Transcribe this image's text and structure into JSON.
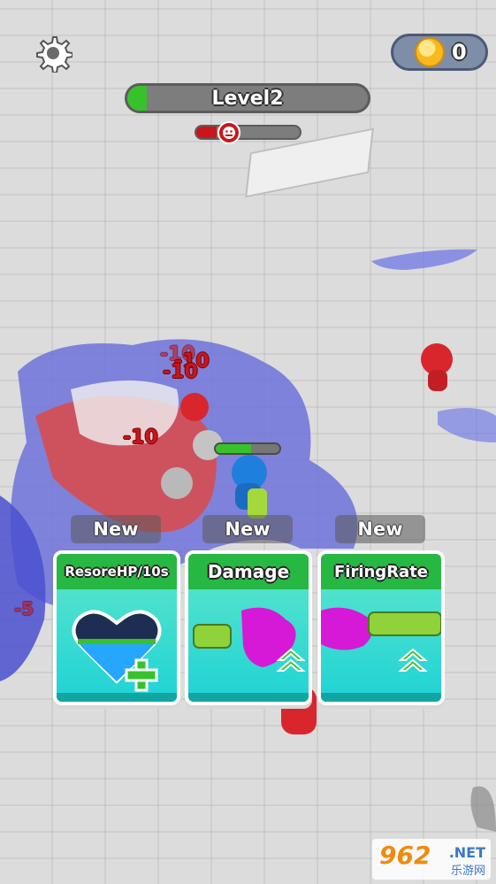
{
  "hud": {
    "settings_icon": "gear-icon",
    "coins": "0",
    "coin_icon": "coin-icon",
    "level_label": "Level2",
    "level_progress": 0.08,
    "boss_progress": 0.2,
    "boss_icon": "demon-face-icon"
  },
  "damage_texts": [
    "-10",
    "-10",
    "-10",
    "-10",
    "-5"
  ],
  "upgrades": {
    "new_labels": [
      "New",
      "New",
      "New"
    ],
    "cards": [
      {
        "title": "ResoreHP/10s",
        "icon": "heart-plus-icon"
      },
      {
        "title": "Damage",
        "icon": "paint-gun-damage-icon"
      },
      {
        "title": "FiringRate",
        "icon": "paint-gun-firing-icon"
      }
    ]
  },
  "watermark": {
    "main": "962",
    "suffix": ".NET",
    "chinese": "乐游网"
  },
  "colors": {
    "accent_green": "#37c22b",
    "boss_red": "#c8161c",
    "card_teal": "#1fd3d6",
    "title_green": "#26b843"
  }
}
